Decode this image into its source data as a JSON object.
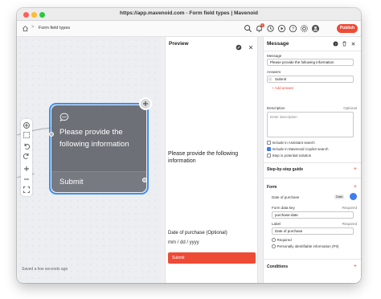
{
  "window": {
    "title": "https://app.mavenoid.com - Form field types | Mavenoid"
  },
  "breadcrumb": {
    "separator": ">",
    "current": "Form field types"
  },
  "toolbar": {
    "badge_count": "1",
    "publish_label": "Publish"
  },
  "canvas": {
    "node_text": "Please provide the following information",
    "node_button": "Submit",
    "saved_status": "Saved a few seconds ago"
  },
  "preview": {
    "title": "Preview",
    "message": "Please provide the following information",
    "date_label": "Date of purchase (Optional)",
    "date_value": "mm / dd / yyyy",
    "submit_label": "Submit"
  },
  "panel": {
    "title": "Message",
    "message_label": "Message",
    "message_value": "Please provide the following information",
    "answers_label": "Answers",
    "answer_1": "Submit",
    "add_answer": "+ Add answer",
    "description_label": "Description",
    "description_optional": "Optional",
    "description_placeholder": "Enter description",
    "opt_assistant": "Include in Assistant search",
    "opt_copilot": "Include in Mavenoid Copilot search",
    "opt_potential": "Step is potential solution",
    "step_by_step": "Step-by-step guide",
    "form_section": "Form",
    "form_item": "Date of purchase",
    "form_item_tag": "Date",
    "form_data_key_label": "Form data key",
    "form_data_key_required": "Required",
    "form_data_key_value": "purchase-date",
    "label_label": "Label",
    "label_required": "Required",
    "label_value": "Date of purchase",
    "opt_required": "Required",
    "opt_pii": "Personally identifiable information (PII)",
    "conditions": "Conditions"
  },
  "colors": {
    "accent": "#ee4b36",
    "selection": "#3d8ff1",
    "node": "#6d7077"
  },
  "icons": [
    "home-icon",
    "search-icon",
    "bell-icon",
    "history-icon",
    "play-icon",
    "help-icon",
    "settings-icon",
    "avatar-icon",
    "chat-icon",
    "plus-icon",
    "zoom-in-icon",
    "zoom-out-icon",
    "undo-icon",
    "redo-icon",
    "fit-icon",
    "cursor-icon",
    "select-icon",
    "close-icon",
    "trash-icon",
    "drag-icon",
    "edit-icon"
  ]
}
